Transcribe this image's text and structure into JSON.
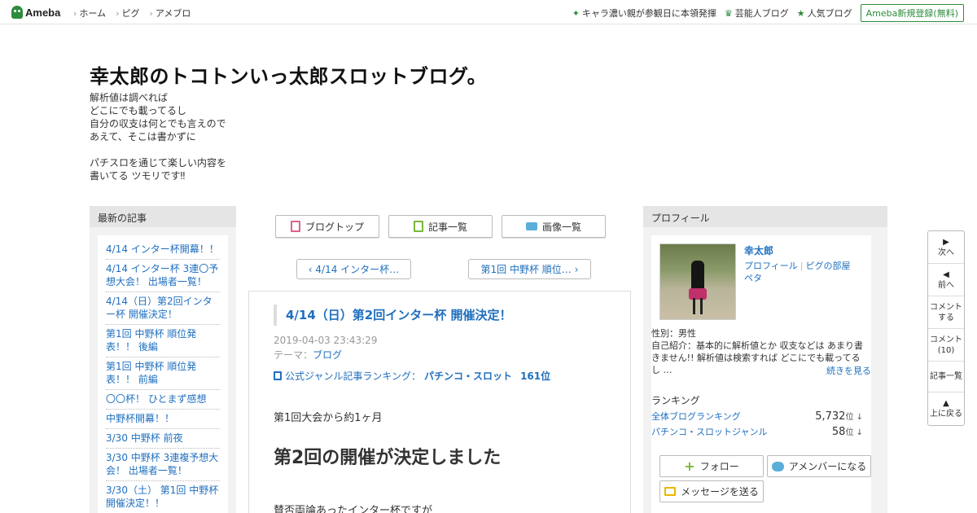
{
  "topbar": {
    "logo": "Ameba",
    "nav": [
      "ホーム",
      "ピグ",
      "アメブロ"
    ],
    "right_links": [
      "キャラ濃い親が参観日に本領発揮",
      "芸能人ブログ",
      "人気ブログ"
    ],
    "register": "Ameba新規登録(無料)"
  },
  "header": {
    "title": "幸太郎のトコトンいっ太郎スロットブログ。",
    "description": "解析値は調べれば\nどこにでも載ってるし\n自分の収支は何とでも言えので\nあえて、そこは書かずに\n\nパチスロを通じて楽しい内容を\n書いてる ツモリです‼"
  },
  "left_sidebar": {
    "heading": "最新の記事",
    "items": [
      "4/14 インター杯開幕！！",
      "4/14 インター杯 3連〇予想大会！ 出場者一覧！",
      "4/14（日）第2回インター杯 開催決定！",
      "第1回 中野杯 順位発表！！ 後編",
      "第1回 中野杯 順位発表！！ 前編",
      "〇〇杯！ ひとまず感想",
      "中野杯開幕！！",
      "3/30 中野杯 前夜",
      "3/30 中野杯 3連複予想大会！ 出場者一覧！",
      "3/30（土） 第1回 中野杯開催決定！！"
    ]
  },
  "tabs": {
    "blog_top": "ブログトップ",
    "article_list": "記事一覧",
    "image_list": "画像一覧"
  },
  "pager": {
    "prev": "4/14 インター杯…",
    "next": "第1回 中野杯 順位…"
  },
  "article": {
    "title": "4/14（日）第2回インター杯 開催決定！",
    "date": "2019-04-03 23:43:29",
    "theme_label": "テーマ：",
    "theme": "ブログ",
    "ranking_label": "公式ジャンル記事ランキング：",
    "ranking_genre": "パチンコ・スロット",
    "ranking_pos": "161位",
    "p1": "第1回大会から約1ヶ月",
    "heading": "第2回の開催が決定しました",
    "p2": "賛否両論あったインター杯ですが"
  },
  "profile": {
    "heading": "プロフィール",
    "name": "幸太郎",
    "link_profile": "プロフィール",
    "link_pig": "ピグの部屋",
    "link_peta": "ペタ",
    "gender": "性別：男性",
    "intro": "自己紹介：基本的に解析値とか 収支などは あまり書きません!! 解析値は検索すれば どこにでも載ってるし …",
    "more": "続きを見る",
    "ranking_heading": "ランキング",
    "rank_all_name": "全体ブログランキング",
    "rank_all_val": "5,732",
    "rank_genre_name": "パチンコ・スロットジャンル",
    "rank_genre_val": "58",
    "rank_unit": "位 ↓",
    "follow": "フォロー",
    "member": "アメンバーになる",
    "message": "メッセージを送る"
  },
  "floatnav": {
    "next": "次へ",
    "prev": "前へ",
    "comment_line1": "コメント",
    "comment_line2": "する",
    "comments_line1": "コメント",
    "comments_line2": "(10)",
    "list": "記事一覧",
    "top": "上に戻る"
  },
  "colors": {
    "brand_green": "#2d8c3c",
    "link_blue": "#1f6fbf"
  }
}
